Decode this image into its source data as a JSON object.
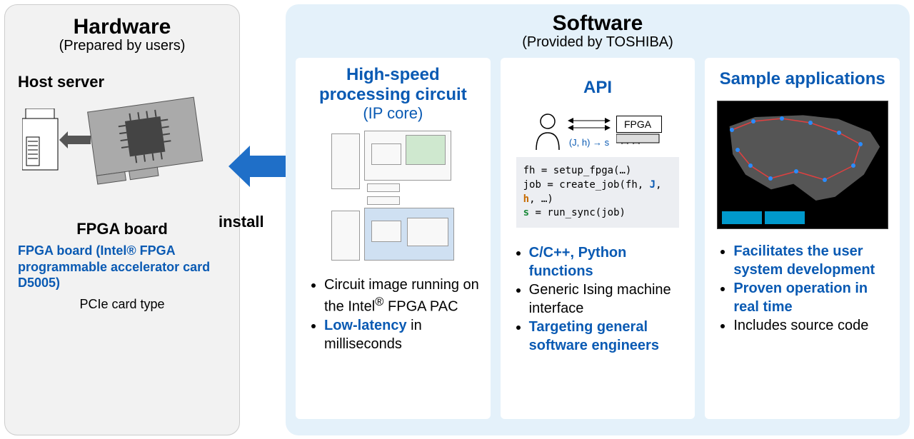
{
  "hardware": {
    "title": "Hardware",
    "subtitle": "(Prepared by users)",
    "host_label": "Host server",
    "fpga_board_label": "FPGA board",
    "fpga_desc": "FPGA board (Intel® FPGA programmable accelerator card D5005)",
    "pcie": "PCIe card type"
  },
  "install_label": "install",
  "software": {
    "title": "Software",
    "subtitle": "(Provided by TOSHIBA)",
    "cards": {
      "ipcore": {
        "title": "High-speed processing circuit",
        "subtitle": "(IP core)",
        "bullet1_pre": "Circuit image running on the Intel",
        "bullet1_post": " FPGA PAC",
        "bullet2_strong": "Low-latency",
        "bullet2_rest": " in milliseconds"
      },
      "api": {
        "title": "API",
        "fpga_box": "FPGA",
        "jh": "(J, h) → s",
        "code_line1_a": "fh =  setup_fpga(…)",
        "code_line2_a": "job = create_job(fh, ",
        "code_line2_j": "J",
        "code_line2_m": ", ",
        "code_line2_h": "h",
        "code_line2_b": ", …)",
        "code_line3_s": "s",
        "code_line3_b": " = run_sync(job)",
        "bullet1": "C/C++, Python functions",
        "bullet2": "Generic Ising machine interface",
        "bullet3": "Targeting general software engineers"
      },
      "sample": {
        "title": "Sample applications",
        "bullet1": "Facilitates the user system development",
        "bullet2": "Proven operation in real time",
        "bullet3": "Includes source code"
      }
    }
  }
}
